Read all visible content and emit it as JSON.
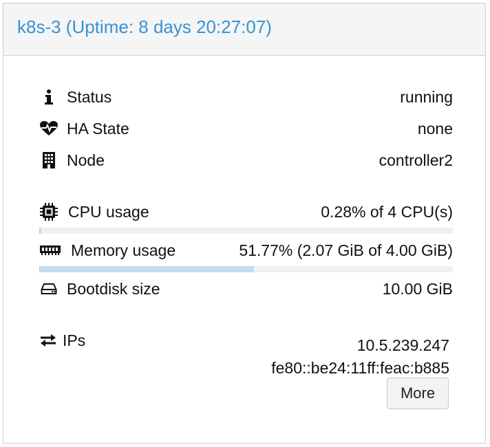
{
  "header": {
    "title": "k8s-3 (Uptime: 8 days 20:27:07)"
  },
  "rows": {
    "status": {
      "label": "Status",
      "value": "running",
      "icon": "info-icon"
    },
    "ha_state": {
      "label": "HA State",
      "value": "none",
      "icon": "heartbeat-icon"
    },
    "node": {
      "label": "Node",
      "value": "controller2",
      "icon": "building-icon"
    },
    "cpu": {
      "label": "CPU usage",
      "value": "0.28% of 4 CPU(s)",
      "icon": "cpu-icon",
      "fraction": 0.0028
    },
    "memory": {
      "label": "Memory usage",
      "value": "51.77% (2.07 GiB of 4.00 GiB)",
      "icon": "memory-icon",
      "fraction": 0.5177
    },
    "bootdisk": {
      "label": "Bootdisk size",
      "value": "10.00 GiB",
      "icon": "hdd-icon"
    },
    "ips": {
      "label": "IPs",
      "icon": "exchange-icon",
      "values": [
        "10.5.239.247",
        "fe80::be24:11ff:feac:b885"
      ]
    }
  },
  "more_button": {
    "label": "More"
  },
  "colors": {
    "title": "#3892d4",
    "bar_fill": "#c5dcf2",
    "bar_track": "#f0f0f0"
  }
}
